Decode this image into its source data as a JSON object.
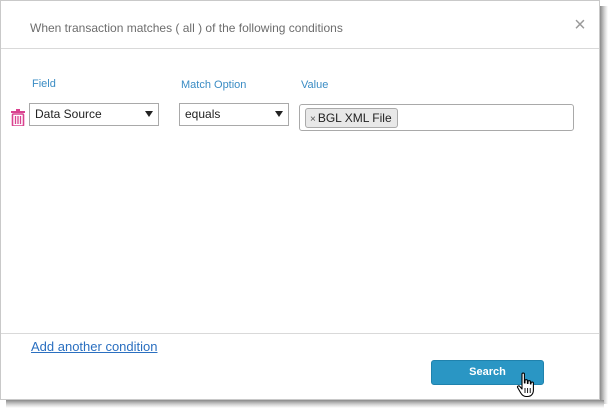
{
  "dialog": {
    "title": "When transaction matches ( all ) of the following conditions",
    "close_glyph": "×"
  },
  "columns": {
    "field": "Field",
    "match_option": "Match Option",
    "value": "Value"
  },
  "condition": {
    "field_value": "Data Source",
    "match_value": "equals",
    "value_chip": "BGL XML File",
    "chip_remove_glyph": "×"
  },
  "footer": {
    "add_condition_label": "Add another condition",
    "search_label": "Search"
  },
  "colors": {
    "accent_button": "#2a96c4",
    "label_blue": "#3a8cc4",
    "link_blue": "#2a6fc0",
    "trash_pink": "#d9428f"
  },
  "icons": {
    "close": "close-icon",
    "trash": "trash-icon",
    "dropdown": "chevron-down-icon",
    "cursor": "hand-pointer-icon"
  }
}
